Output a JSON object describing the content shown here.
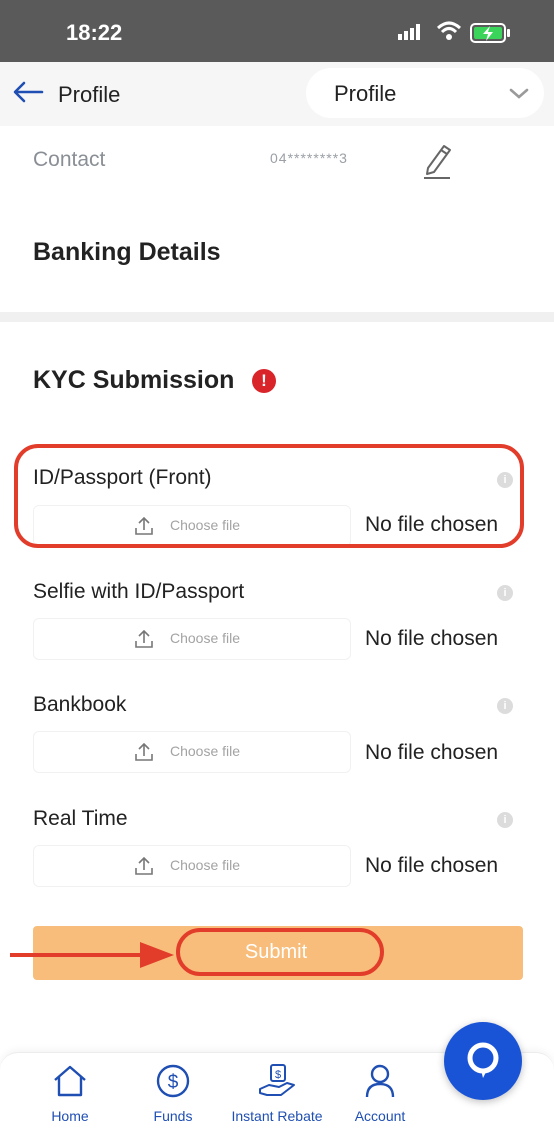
{
  "status_bar": {
    "time": "18:22"
  },
  "header": {
    "back_label": "Profile",
    "dropdown_value": "Profile"
  },
  "profile": {
    "contact_label": "Contact",
    "contact_value": "04********3",
    "banking_title": "Banking Details"
  },
  "kyc": {
    "title": "KYC Submission",
    "warning_symbol": "!",
    "fields": [
      {
        "label": "ID/Passport (Front)",
        "button": "Choose file",
        "status": "No file chosen"
      },
      {
        "label": "Selfie with ID/Passport",
        "button": "Choose file",
        "status": "No file chosen"
      },
      {
        "label": "Bankbook",
        "button": "Choose file",
        "status": "No file chosen"
      },
      {
        "label": "Real Time",
        "button": "Choose file",
        "status": "No file chosen"
      }
    ],
    "submit_label": "Submit"
  },
  "tabbar": {
    "items": [
      {
        "label": "Home",
        "icon": "home-icon"
      },
      {
        "label": "Funds",
        "icon": "dollar-coin-icon"
      },
      {
        "label": "Instant Rebate",
        "icon": "rebate-hand-icon"
      },
      {
        "label": "Account",
        "icon": "user-icon"
      }
    ],
    "chat_icon": "chat-bubble-icon"
  },
  "colors": {
    "accent_blue": "#1f4fb3",
    "chat_blue": "#1a54d6",
    "submit_orange": "#f8bd7a",
    "highlight_red": "#e23c2a",
    "warning_red": "#d9242a"
  }
}
